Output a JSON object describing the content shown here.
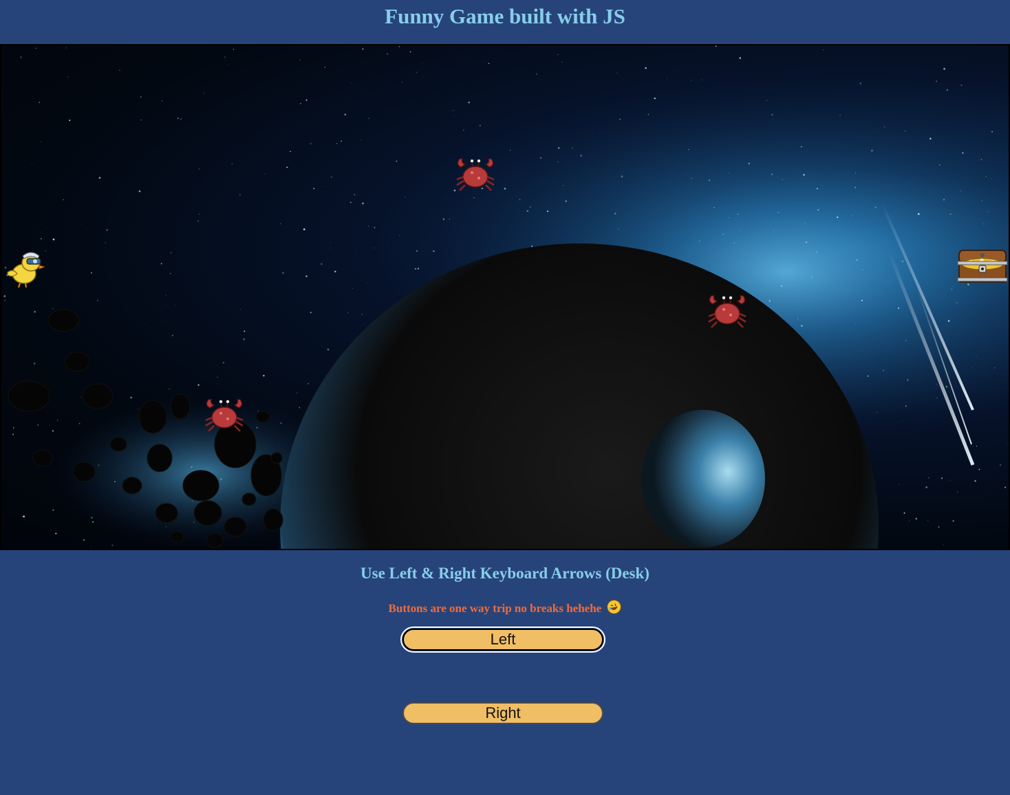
{
  "header": {
    "title": "Funny Game built with JS"
  },
  "game": {
    "background": "space scene with planet and asteroids",
    "player": {
      "icon": "chick-with-goggles-icon"
    },
    "goal": {
      "icon": "treasure-chest-icon"
    },
    "enemies": [
      {
        "icon": "crab-icon"
      },
      {
        "icon": "crab-icon"
      },
      {
        "icon": "crab-icon"
      }
    ]
  },
  "instructions": {
    "text": "Use Left & Right Keyboard Arrows (Desk)",
    "note": "Buttons are one way trip no breaks hehehe",
    "note_emoji": "rolling-on-floor-laughing-icon"
  },
  "controls": {
    "left_label": "Left",
    "right_label": "Right"
  },
  "colors": {
    "page_background": "#27447a",
    "title_color": "#87ceeb",
    "note_color": "#f26b3a",
    "button_color": "#f0be65"
  }
}
